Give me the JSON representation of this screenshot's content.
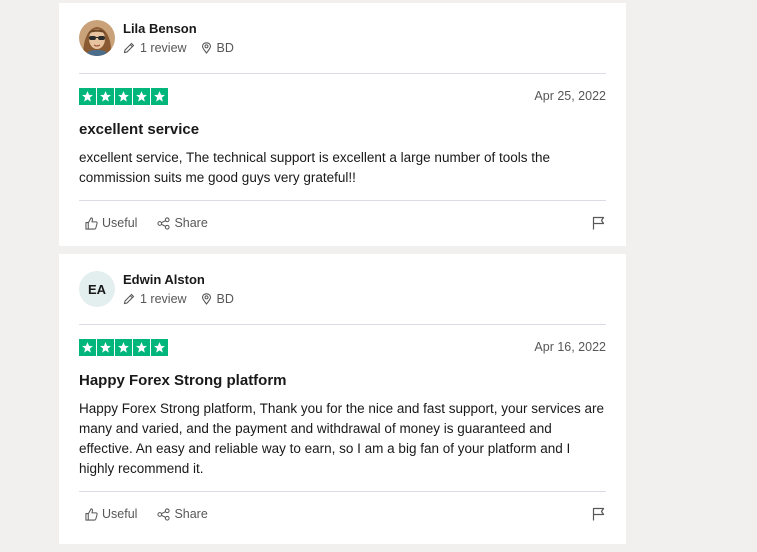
{
  "reviews": [
    {
      "name": "Lila Benson",
      "avatar_type": "photo",
      "review_count": "1 review",
      "country": "BD",
      "stars": 5,
      "date": "Apr 25, 2022",
      "title": "excellent service",
      "body": "excellent service, The technical support is excellent a large number of tools the commission suits me good guys very grateful!!",
      "useful_label": "Useful",
      "share_label": "Share"
    },
    {
      "name": "Edwin Alston",
      "avatar_type": "initials",
      "initials": "EA",
      "review_count": "1 review",
      "country": "BD",
      "stars": 5,
      "date": "Apr 16, 2022",
      "title": "Happy Forex Strong platform",
      "body": "Happy Forex Strong platform, Thank you for the nice and fast support, your services are many and varied, and the payment and withdrawal of money is guaranteed and effective. An easy and reliable way to earn, so I am a big fan of your platform and I highly recommend it.",
      "useful_label": "Useful",
      "share_label": "Share"
    }
  ],
  "colors": {
    "star_green": "#00b67a",
    "page_bg": "#f1f0ee",
    "card_bg": "#ffffff",
    "muted_text": "#575757"
  },
  "icons": [
    "pencil-icon",
    "location-pin-icon",
    "star-icon",
    "thumbs-up-icon",
    "share-icon",
    "flag-icon"
  ]
}
